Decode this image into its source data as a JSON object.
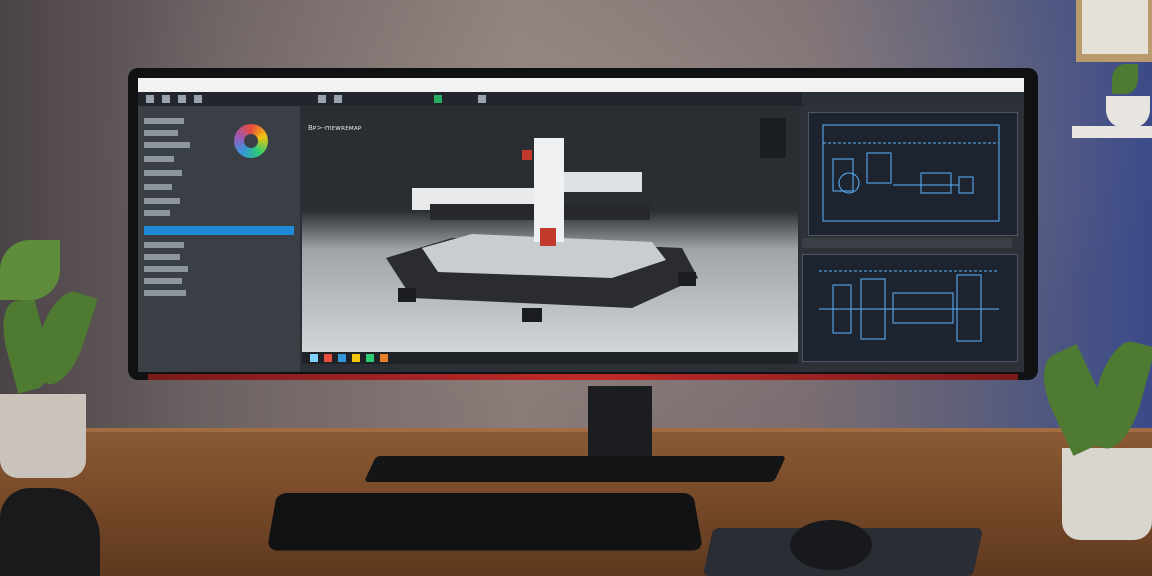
{
  "scene": {
    "description_shown": false
  },
  "app": {
    "title_bar_text": "",
    "viewport_label": "Bᴘ>-mᴇᴡʀᴇᴍᴀᴘ",
    "left_panel_selected": "",
    "toolbar_icons": [
      "file-icon",
      "edit-icon",
      "view-icon",
      "tools-icon",
      "render-icon",
      "grid-icon",
      "measure-icon",
      "settings-icon"
    ],
    "taskbar_icons": [
      "start-icon",
      "search-icon",
      "browser-icon",
      "files-icon",
      "mail-icon",
      "app-icon"
    ],
    "right_panel_tabs": [
      "",
      "",
      ""
    ],
    "accent": "#1f8bd6"
  },
  "colors": {
    "screen_bg": "#2b2f36",
    "panel": "#3a3f46",
    "blueprint_line": "#5ab4ff",
    "machine_frame": "#2a2c30",
    "machine_accent": "#c0392b"
  }
}
